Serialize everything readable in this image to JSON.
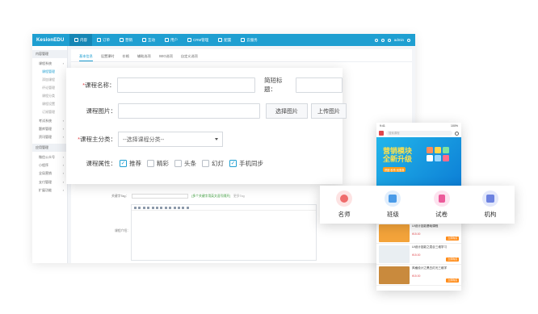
{
  "admin": {
    "brand": "KesionEDU",
    "nav": [
      {
        "label": "内容",
        "icon": "grid-icon"
      },
      {
        "label": "订单",
        "icon": "cart-icon"
      },
      {
        "label": "营销",
        "icon": "tag-icon"
      },
      {
        "label": "互动",
        "icon": "chat-icon"
      },
      {
        "label": "用户",
        "icon": "user-icon"
      },
      {
        "label": "CRM管理",
        "icon": "crm-icon"
      },
      {
        "label": "配置",
        "icon": "gear-icon"
      },
      {
        "label": "云服务",
        "icon": "cloud-icon"
      }
    ],
    "user": "admin",
    "sidebar": {
      "section1": "内容管理",
      "items1": [
        "课程系统",
        "考试系统",
        "题库管理",
        "资讯管理",
        "栏目管理"
      ],
      "subitems": [
        "课程管理",
        "添加课程",
        "评论管理",
        "课程分类",
        "课程设置",
        "订阅管理"
      ],
      "section2": "应用管理",
      "items2": [
        "微信公众号",
        "小程序",
        "全局营销",
        "支付管理",
        "扩展功能"
      ]
    },
    "tabs": [
      "基本信息",
      "设置课时",
      "价格",
      "辅助选项",
      "SEO选项",
      "自定义选项"
    ],
    "bg_field_label": "关键字Tag：",
    "bg_field_tip": "[多个关键字用英文逗号隔开]",
    "bg_field_gray": "更多Tag",
    "editor_label": "课程介绍："
  },
  "form": {
    "title_label": "课程名称：",
    "short_title_label": "简短标题：",
    "image_label": "课程图片：",
    "select_image_button": "选择图片",
    "upload_image_button": "上传图片",
    "category_label": "课程主分类：",
    "category_placeholder": "--选择课程分类--",
    "attributes_label": "课程属性：",
    "attributes": [
      {
        "label": "推荐",
        "checked": true
      },
      {
        "label": "精彩",
        "checked": false
      },
      {
        "label": "头条",
        "checked": false
      },
      {
        "label": "幻灯",
        "checked": false
      },
      {
        "label": "手机同步",
        "checked": true
      }
    ]
  },
  "phone": {
    "status_left": "9:41",
    "status_right": "100%",
    "search_placeholder": "搜索课程",
    "banner_title_1": "营销模块",
    "banner_title_2": "全新升级",
    "banner_pill": "拼团·秒杀·优惠券",
    "items": [
      {
        "title": "UI设计技能基础课程",
        "price": "¥15.00",
        "button": "立即购买",
        "thumb_color": "#f3a33a"
      },
      {
        "title": "UI设计技能之混合三维学习",
        "price": "¥15.00",
        "button": "立即购买",
        "thumb_color": "#e9eef2"
      },
      {
        "title": "风格设计之黑白灯光三维学",
        "price": "¥15.00",
        "button": "立即购买",
        "thumb_color": "#c98a3d"
      }
    ]
  },
  "categories": [
    {
      "label": "名师",
      "icon": "teacher-icon",
      "bg": "#fde3e3",
      "fg": "#ef6c6c"
    },
    {
      "label": "班级",
      "icon": "class-icon",
      "bg": "#e1eefc",
      "fg": "#4a9be8"
    },
    {
      "label": "试卷",
      "icon": "paper-icon",
      "bg": "#fde3ef",
      "fg": "#ec5b9a"
    },
    {
      "label": "机构",
      "icon": "org-icon",
      "bg": "#e3e8fb",
      "fg": "#6d82e0"
    }
  ]
}
